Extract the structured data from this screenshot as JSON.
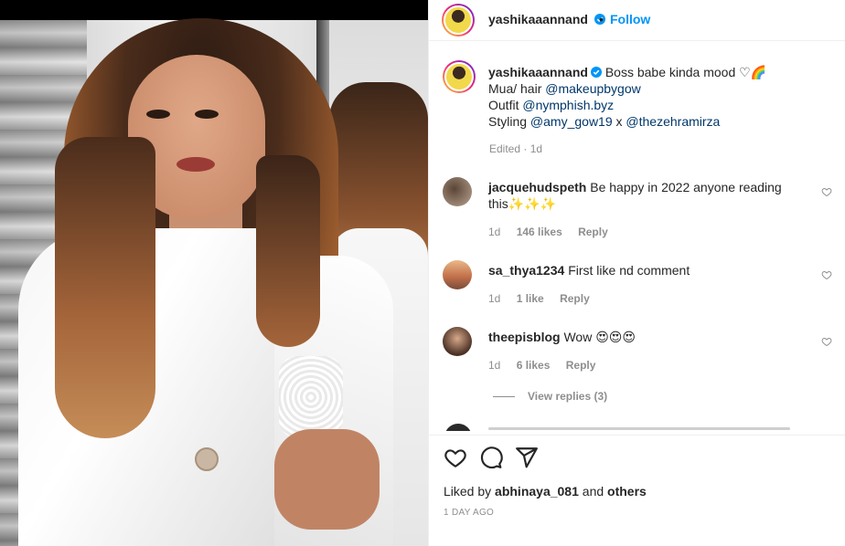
{
  "post": {
    "username": "yashikaaannand",
    "follow_label": "Follow",
    "dot": "•",
    "caption": {
      "username": "yashikaaannand",
      "line1": "Boss babe kinda mood ♡🌈",
      "line2_prefix": "Mua/ hair ",
      "line2_mention": "@makeupbygow",
      "line3_prefix": "Outfit ",
      "line3_mention": "@nymphish.byz",
      "line4_prefix": "Styling ",
      "line4_mention1": "@amy_gow19",
      "line4_sep": " x ",
      "line4_mention2": "@thezehramirza",
      "meta": "Edited · 1d"
    },
    "comments": [
      {
        "username": "jacquehudspeth",
        "text": "Be happy in 2022 anyone reading this✨✨✨",
        "time": "1d",
        "likes": "146 likes",
        "reply": "Reply"
      },
      {
        "username": "sa_thya1234",
        "text": "First like nd comment",
        "time": "1d",
        "likes": "1 like",
        "reply": "Reply"
      },
      {
        "username": "theepisblog",
        "text": "Wow 😍😍😍",
        "time": "1d",
        "likes": "6 likes",
        "reply": "Reply"
      }
    ],
    "view_replies": "View replies (3)",
    "liked_by_prefix": "Liked by ",
    "liked_by_user": "abhinaya_081",
    "liked_by_sep": " and ",
    "liked_by_others": "others",
    "date": "1 DAY AGO"
  },
  "colors": {
    "link": "#0095f6",
    "mention": "#00376b",
    "muted": "#8e8e8e",
    "text": "#262626"
  },
  "icons": [
    "verified-badge-icon",
    "heart-icon",
    "comment-icon",
    "share-icon"
  ]
}
